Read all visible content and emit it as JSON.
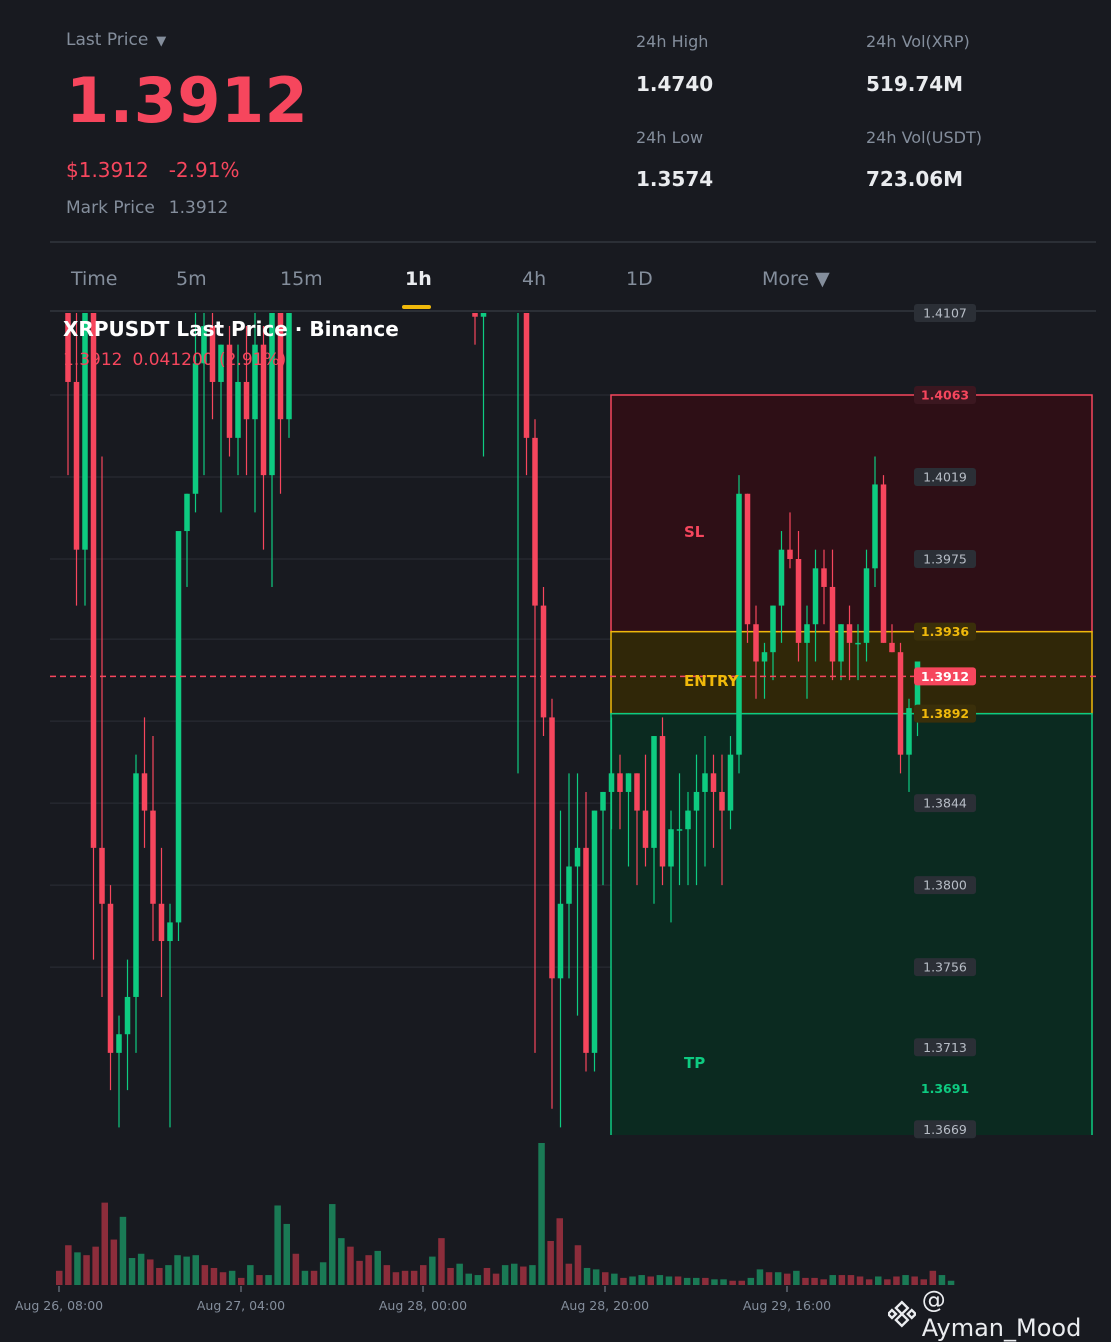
{
  "ticker": {
    "last_price_label": "Last Price",
    "last_price": "1.3912",
    "usd_price": "$1.3912",
    "change_pct": "-2.91%",
    "mark_price_label": "Mark Price",
    "mark_price": "1.3912"
  },
  "stats": {
    "high_label": "24h High",
    "high": "1.4740",
    "low_label": "24h Low",
    "low": "1.3574",
    "vol_base_label": "24h Vol(XRP)",
    "vol_base": "519.74M",
    "vol_quote_label": "24h Vol(USDT)",
    "vol_quote": "723.06M"
  },
  "timeframes": [
    {
      "label": "Time",
      "active": false
    },
    {
      "label": "5m",
      "active": false
    },
    {
      "label": "15m",
      "active": false
    },
    {
      "label": "1h",
      "active": true
    },
    {
      "label": "4h",
      "active": false
    },
    {
      "label": "1D",
      "active": false
    },
    {
      "label": "More ▼",
      "active": false
    }
  ],
  "chart": {
    "title": "XRPUSDT Last Price · Binance",
    "sub_price": "1.3912",
    "sub_change": "0.041200 (2.91%)",
    "zones": {
      "sl_label": "SL",
      "entry_label": "ENTRY",
      "tp_label": "TP"
    },
    "watermark": "@ Ayman_Mood"
  },
  "colors": {
    "up": "#0ecb81",
    "down": "#f6465d",
    "accent": "#f0b90b",
    "sl_zone": "#2e0f16",
    "entry_zone": "#302708",
    "tp_zone": "#0b2a20"
  },
  "chart_data": {
    "type": "candlestick",
    "y_range": [
      1.3669,
      1.4107
    ],
    "y_ticks": [
      "1.4107",
      "1.4063",
      "1.4019",
      "1.3975",
      "1.3936",
      "1.3912",
      "1.3892",
      "1.3844",
      "1.3800",
      "1.3756",
      "1.3713",
      "1.3691",
      "1.3669"
    ],
    "price_levels": {
      "stop_loss": 1.4063,
      "entry_high": 1.3936,
      "last_price": 1.3912,
      "entry_low": 1.3892,
      "take_profit": 1.3691
    },
    "x_labels": [
      "Aug 26, 08:00",
      "Aug 27, 04:00",
      "Aug 28, 00:00",
      "Aug 28, 20:00",
      "Aug 29, 16:00"
    ],
    "segments": [
      {
        "name": "left",
        "candles": [
          [
            1.412,
            1.412,
            1.402,
            1.407
          ],
          [
            1.407,
            1.412,
            1.395,
            1.398
          ],
          [
            1.398,
            1.414,
            1.395,
            1.412
          ],
          [
            1.412,
            1.414,
            1.376,
            1.382
          ],
          [
            1.382,
            1.403,
            1.374,
            1.379
          ],
          [
            1.379,
            1.38,
            1.369,
            1.371
          ],
          [
            1.371,
            1.373,
            1.367,
            1.372
          ],
          [
            1.372,
            1.376,
            1.369,
            1.374
          ],
          [
            1.374,
            1.387,
            1.371,
            1.386
          ],
          [
            1.386,
            1.389,
            1.382,
            1.384
          ],
          [
            1.384,
            1.388,
            1.377,
            1.379
          ],
          [
            1.379,
            1.382,
            1.374,
            1.377
          ],
          [
            1.377,
            1.379,
            1.367,
            1.378
          ],
          [
            1.378,
            1.398,
            1.377,
            1.399
          ],
          [
            1.399,
            1.401,
            1.396,
            1.401
          ],
          [
            1.401,
            1.411,
            1.4,
            1.408
          ],
          [
            1.408,
            1.411,
            1.402,
            1.41
          ],
          [
            1.41,
            1.411,
            1.405,
            1.407
          ],
          [
            1.407,
            1.409,
            1.4,
            1.409
          ],
          [
            1.409,
            1.41,
            1.403,
            1.404
          ],
          [
            1.404,
            1.409,
            1.402,
            1.407
          ],
          [
            1.407,
            1.41,
            1.402,
            1.405
          ],
          [
            1.405,
            1.412,
            1.4,
            1.409
          ],
          [
            1.409,
            1.41,
            1.398,
            1.402
          ],
          [
            1.402,
            1.411,
            1.396,
            1.412
          ],
          [
            1.412,
            1.412,
            1.401,
            1.405
          ],
          [
            1.405,
            1.412,
            1.404,
            1.412
          ]
        ]
      },
      {
        "name": "middle",
        "candles": [
          [
            1.4107,
            1.411,
            1.409,
            1.4105
          ],
          [
            1.4105,
            1.411,
            1.403,
            1.411
          ]
        ]
      },
      {
        "name": "right",
        "candles": [
          [
            1.4107,
            1.411,
            1.386,
            1.411
          ],
          [
            1.411,
            1.411,
            1.402,
            1.404
          ],
          [
            1.404,
            1.405,
            1.371,
            1.395
          ],
          [
            1.395,
            1.396,
            1.388,
            1.389
          ],
          [
            1.389,
            1.39,
            1.368,
            1.375
          ],
          [
            1.375,
            1.384,
            1.367,
            1.379
          ],
          [
            1.379,
            1.386,
            1.375,
            1.381
          ],
          [
            1.381,
            1.386,
            1.373,
            1.382
          ],
          [
            1.382,
            1.385,
            1.37,
            1.371
          ],
          [
            1.371,
            1.384,
            1.37,
            1.384
          ],
          [
            1.384,
            1.385,
            1.38,
            1.385
          ],
          [
            1.385,
            1.389,
            1.383,
            1.386
          ],
          [
            1.386,
            1.387,
            1.383,
            1.385
          ],
          [
            1.385,
            1.386,
            1.381,
            1.386
          ],
          [
            1.386,
            1.386,
            1.38,
            1.384
          ],
          [
            1.384,
            1.387,
            1.381,
            1.382
          ],
          [
            1.382,
            1.388,
            1.379,
            1.388
          ],
          [
            1.388,
            1.389,
            1.38,
            1.381
          ],
          [
            1.381,
            1.384,
            1.378,
            1.383
          ],
          [
            1.383,
            1.386,
            1.38,
            1.383
          ],
          [
            1.383,
            1.385,
            1.38,
            1.384
          ],
          [
            1.384,
            1.387,
            1.38,
            1.385
          ],
          [
            1.385,
            1.388,
            1.381,
            1.386
          ],
          [
            1.386,
            1.387,
            1.382,
            1.385
          ],
          [
            1.385,
            1.387,
            1.38,
            1.384
          ],
          [
            1.384,
            1.388,
            1.383,
            1.387
          ],
          [
            1.387,
            1.402,
            1.386,
            1.401
          ],
          [
            1.401,
            1.401,
            1.393,
            1.394
          ],
          [
            1.394,
            1.395,
            1.39,
            1.392
          ],
          [
            1.392,
            1.393,
            1.39,
            1.3925
          ],
          [
            1.3925,
            1.395,
            1.391,
            1.395
          ],
          [
            1.395,
            1.399,
            1.393,
            1.398
          ],
          [
            1.398,
            1.4,
            1.397,
            1.3975
          ],
          [
            1.3975,
            1.399,
            1.392,
            1.393
          ],
          [
            1.393,
            1.395,
            1.39,
            1.394
          ],
          [
            1.394,
            1.398,
            1.392,
            1.397
          ],
          [
            1.397,
            1.398,
            1.394,
            1.396
          ],
          [
            1.396,
            1.398,
            1.391,
            1.392
          ],
          [
            1.392,
            1.394,
            1.391,
            1.394
          ],
          [
            1.394,
            1.395,
            1.391,
            1.393
          ],
          [
            1.393,
            1.394,
            1.391,
            1.393
          ],
          [
            1.393,
            1.398,
            1.392,
            1.397
          ],
          [
            1.397,
            1.403,
            1.396,
            1.4015
          ],
          [
            1.4015,
            1.402,
            1.393,
            1.393
          ],
          [
            1.393,
            1.394,
            1.3925,
            1.3925
          ],
          [
            1.3925,
            1.393,
            1.386,
            1.387
          ],
          [
            1.387,
            1.39,
            1.385,
            1.3895
          ],
          [
            1.3895,
            1.392,
            1.388,
            1.392
          ]
        ]
      }
    ],
    "volume_candles": [
      [
        0.1,
        0
      ],
      [
        0.28,
        0
      ],
      [
        0.23,
        1
      ],
      [
        0.21,
        0
      ],
      [
        0.27,
        0
      ],
      [
        0.58,
        0
      ],
      [
        0.32,
        0
      ],
      [
        0.48,
        1
      ],
      [
        0.19,
        1
      ],
      [
        0.22,
        1
      ],
      [
        0.18,
        0
      ],
      [
        0.12,
        0
      ],
      [
        0.14,
        1
      ],
      [
        0.21,
        1
      ],
      [
        0.2,
        1
      ],
      [
        0.21,
        1
      ],
      [
        0.14,
        0
      ],
      [
        0.12,
        0
      ],
      [
        0.09,
        0
      ],
      [
        0.1,
        1
      ],
      [
        0.05,
        0
      ],
      [
        0.14,
        1
      ],
      [
        0.07,
        0
      ],
      [
        0.07,
        1
      ],
      [
        0.56,
        1
      ],
      [
        0.43,
        1
      ],
      [
        0.22,
        0
      ],
      [
        0.1,
        1
      ],
      [
        0.1,
        0
      ],
      [
        0.16,
        1
      ],
      [
        0.57,
        1
      ],
      [
        0.33,
        1
      ],
      [
        0.27,
        0
      ],
      [
        0.17,
        0
      ],
      [
        0.21,
        0
      ],
      [
        0.24,
        1
      ],
      [
        0.14,
        0
      ],
      [
        0.09,
        0
      ],
      [
        0.1,
        0
      ],
      [
        0.1,
        0
      ],
      [
        0.14,
        0
      ],
      [
        0.2,
        1
      ],
      [
        0.33,
        0
      ],
      [
        0.12,
        0
      ],
      [
        0.15,
        1
      ],
      [
        0.08,
        1
      ],
      [
        0.07,
        1
      ],
      [
        0.12,
        0
      ],
      [
        0.08,
        0
      ],
      [
        0.14,
        1
      ],
      [
        0.15,
        1
      ],
      [
        0.13,
        0
      ],
      [
        0.14,
        1
      ],
      [
        1.0,
        1
      ],
      [
        0.31,
        0
      ],
      [
        0.47,
        0
      ],
      [
        0.15,
        0
      ],
      [
        0.28,
        0
      ],
      [
        0.12,
        1
      ],
      [
        0.11,
        1
      ],
      [
        0.09,
        0
      ],
      [
        0.08,
        1
      ],
      [
        0.05,
        0
      ],
      [
        0.06,
        1
      ],
      [
        0.07,
        1
      ],
      [
        0.06,
        0
      ],
      [
        0.07,
        1
      ],
      [
        0.06,
        1
      ],
      [
        0.06,
        0
      ],
      [
        0.05,
        1
      ],
      [
        0.05,
        1
      ],
      [
        0.05,
        0
      ],
      [
        0.04,
        1
      ],
      [
        0.04,
        1
      ],
      [
        0.03,
        0
      ],
      [
        0.03,
        0
      ],
      [
        0.05,
        1
      ],
      [
        0.11,
        1
      ],
      [
        0.09,
        0
      ],
      [
        0.09,
        1
      ],
      [
        0.08,
        0
      ],
      [
        0.1,
        1
      ],
      [
        0.05,
        0
      ],
      [
        0.05,
        0
      ],
      [
        0.04,
        0
      ],
      [
        0.07,
        1
      ],
      [
        0.07,
        0
      ],
      [
        0.07,
        0
      ],
      [
        0.06,
        0
      ],
      [
        0.04,
        0
      ],
      [
        0.06,
        1
      ],
      [
        0.04,
        0
      ],
      [
        0.06,
        0
      ],
      [
        0.07,
        1
      ],
      [
        0.06,
        0
      ],
      [
        0.04,
        0
      ],
      [
        0.1,
        0
      ],
      [
        0.07,
        1
      ],
      [
        0.03,
        1
      ]
    ]
  }
}
